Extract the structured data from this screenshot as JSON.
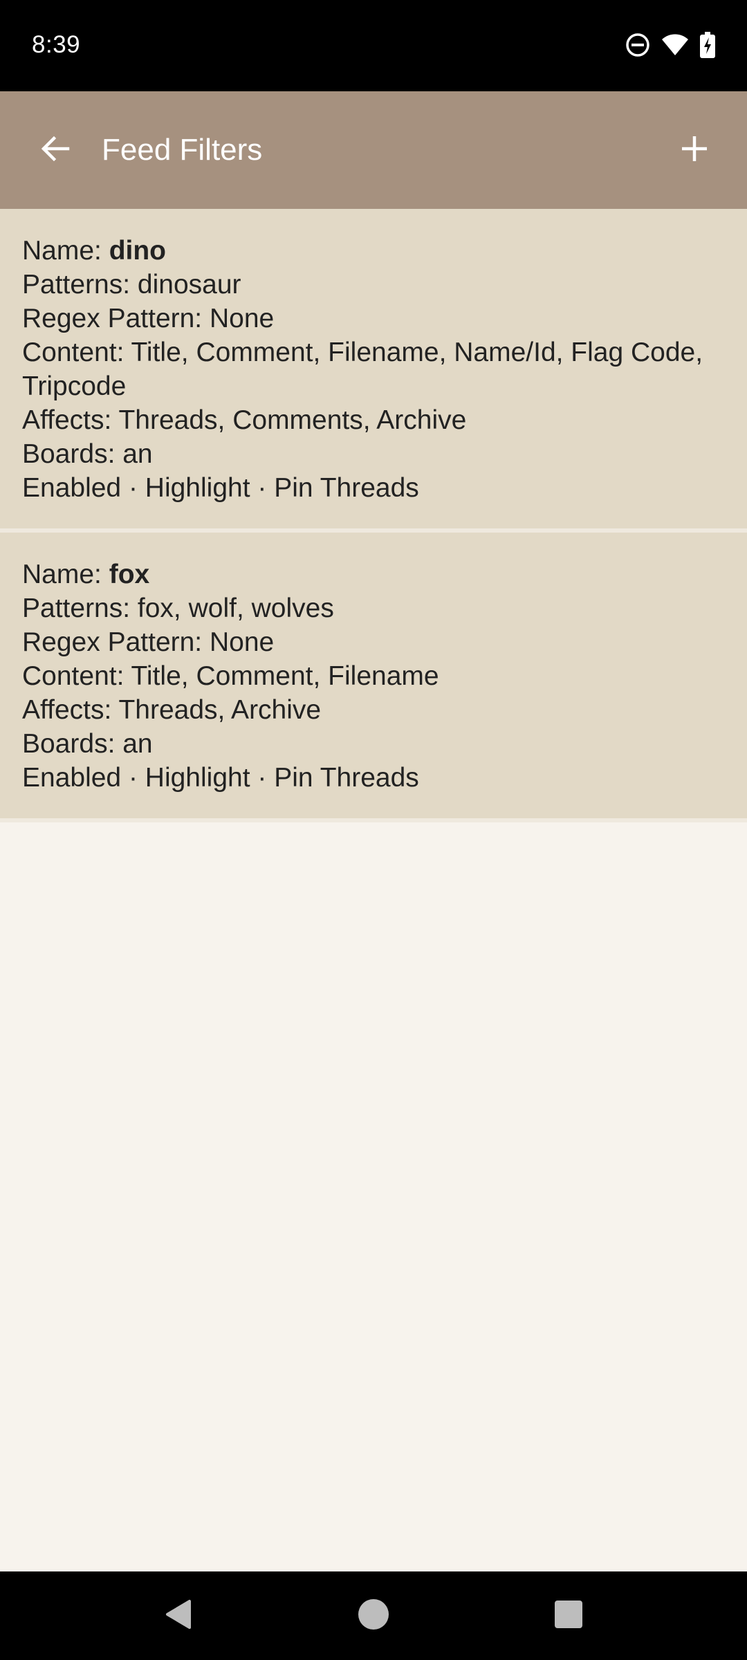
{
  "status_bar": {
    "time": "8:39",
    "icons": [
      "do-not-disturb-icon",
      "wifi-icon",
      "battery-charging-icon"
    ]
  },
  "app_bar": {
    "title": "Feed Filters",
    "back_icon": "arrow-left-icon",
    "add_icon": "plus-icon"
  },
  "filters": [
    {
      "name_label": "Name: ",
      "name": "dino",
      "patterns": "Patterns: dinosaur",
      "regex": "Regex Pattern: None",
      "content": "Content: Title, Comment, Filename, Name/Id, Flag Code, Tripcode",
      "affects": "Affects: Threads, Comments, Archive",
      "boards": "Boards: an",
      "status": "Enabled · Highlight · Pin Threads"
    },
    {
      "name_label": "Name: ",
      "name": "fox",
      "patterns": "Patterns: fox, wolf, wolves",
      "regex": "Regex Pattern: None",
      "content": "Content: Title, Comment, Filename",
      "affects": "Affects: Threads, Archive",
      "boards": "Boards: an",
      "status": "Enabled · Highlight · Pin Threads"
    }
  ],
  "nav_bar": {
    "icons": [
      "nav-back-icon",
      "nav-home-icon",
      "nav-recents-icon"
    ]
  },
  "colors": {
    "app_bar": "#a6917f",
    "card": "#e2d9c6",
    "background": "#f7f3ed",
    "system_bars": "#000000"
  }
}
